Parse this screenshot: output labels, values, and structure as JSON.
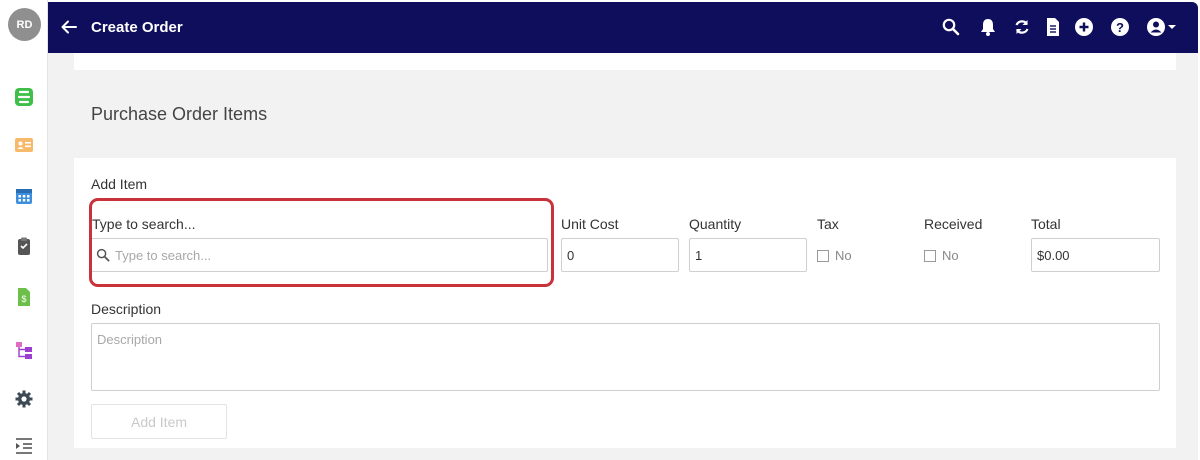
{
  "user": {
    "initials": "RD"
  },
  "header": {
    "title": "Create Order"
  },
  "page": {
    "section_title": "Purchase Order Items"
  },
  "form": {
    "add_item_heading": "Add Item",
    "search_label": "Type to search...",
    "search_placeholder": "Type to search...",
    "unit_cost_label": "Unit Cost",
    "unit_cost_value": "0",
    "quantity_label": "Quantity",
    "quantity_value": "1",
    "tax_label": "Tax",
    "tax_option": "No",
    "received_label": "Received",
    "received_option": "No",
    "total_label": "Total",
    "total_value": "$0.00",
    "description_label": "Description",
    "description_placeholder": "Description",
    "add_item_button": "Add Item"
  },
  "colors": {
    "header_bg": "#0e0e5c",
    "highlight": "#c8323a"
  },
  "sidebar_icons": [
    "brand-logo-icon",
    "contact-card-icon",
    "calendar-icon",
    "clipboard-icon",
    "invoice-icon",
    "hierarchy-icon",
    "gear-icon",
    "indent-icon"
  ],
  "toolbar_icons": [
    "search-icon",
    "bell-icon",
    "sync-icon",
    "document-icon",
    "plus-circle-icon",
    "help-icon",
    "account-icon"
  ]
}
